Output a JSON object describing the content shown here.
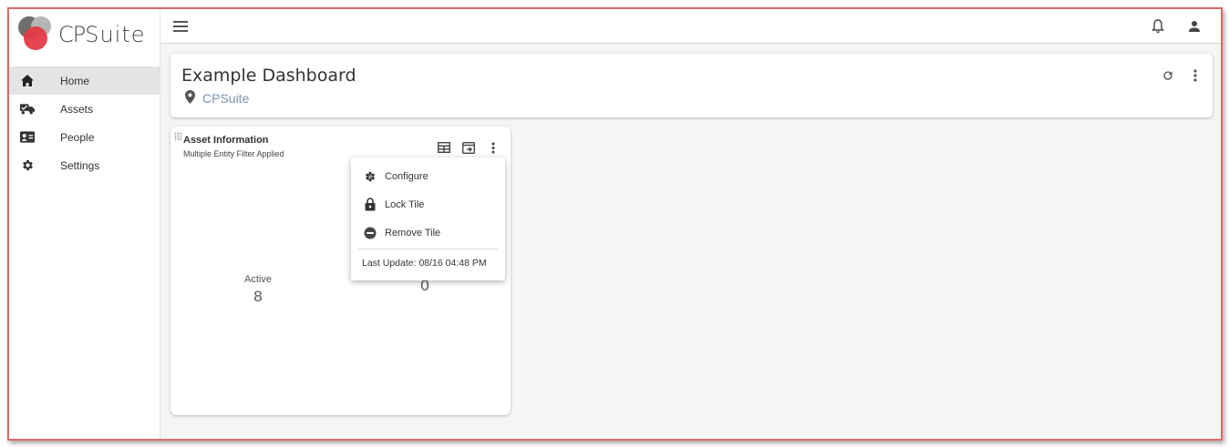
{
  "app": {
    "logo_text_cp": "CP",
    "logo_text_suite": "Suite"
  },
  "sidebar": {
    "items": [
      {
        "label": "Home",
        "icon": "home-icon"
      },
      {
        "label": "Assets",
        "icon": "truck-check-icon"
      },
      {
        "label": "People",
        "icon": "id-card-icon"
      },
      {
        "label": "Settings",
        "icon": "gear-icon"
      }
    ],
    "active": "Home"
  },
  "topbar": {
    "menu_icon": "hamburger-icon",
    "notification_icon": "bell-icon",
    "user_icon": "user-icon"
  },
  "dashboard": {
    "title": "Example Dashboard",
    "location": "CPSuite",
    "location_icon": "map-pin-icon",
    "actions": [
      "refresh-icon",
      "more-vert-icon"
    ]
  },
  "tile": {
    "title": "Asset Information",
    "subtitle": "Multiple Entity Filter Applied",
    "actions": [
      "table-icon",
      "export-icon",
      "more-vert-icon"
    ],
    "stats": [
      {
        "label": "Active",
        "value": "8"
      },
      {
        "label": "",
        "value": "0"
      }
    ]
  },
  "tile_menu": {
    "items": [
      {
        "label": "Configure",
        "icon": "gear-search-icon"
      },
      {
        "label": "Lock Tile",
        "icon": "lock-icon"
      },
      {
        "label": "Remove Tile",
        "icon": "minus-circle-icon"
      }
    ],
    "footer": "Last Update: 08/16 04:48 PM"
  },
  "colors": {
    "accent_red": "#e23b45",
    "frame_border": "#e06a6a",
    "location_text": "#7a93b0"
  }
}
